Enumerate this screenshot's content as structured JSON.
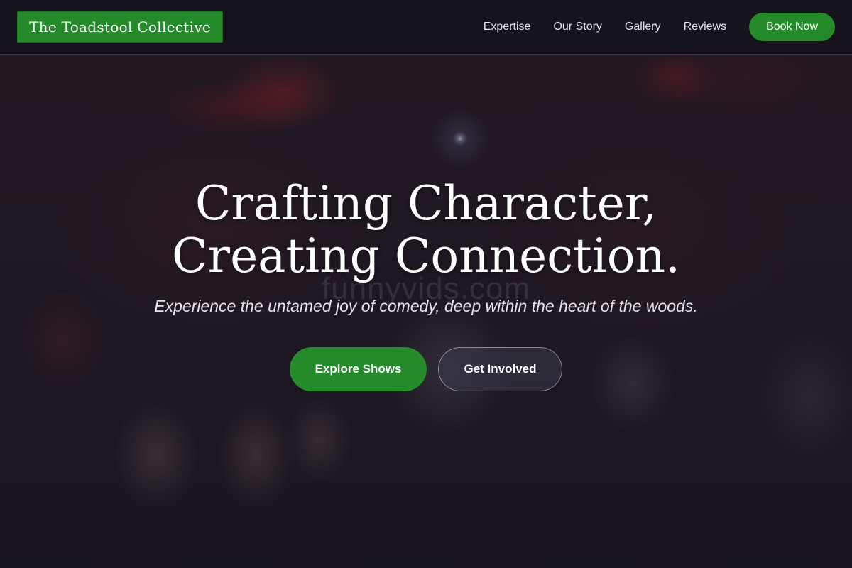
{
  "header": {
    "logo_text": "The Toadstool Collective",
    "nav": [
      {
        "label": "Expertise"
      },
      {
        "label": "Our Story"
      },
      {
        "label": "Gallery"
      },
      {
        "label": "Reviews"
      }
    ],
    "book_button": "Book Now"
  },
  "hero": {
    "title_line1": "Crafting Character,",
    "title_line2": "Creating Connection.",
    "subtitle": "Experience the untamed joy of comedy, deep within the heart of the woods.",
    "watermark": "funnyvids.com",
    "primary_button": "Explore Shows",
    "secondary_button": "Get Involved"
  },
  "colors": {
    "accent_green": "#248a2a",
    "header_bg": "#12121c",
    "text": "#ffffff"
  }
}
